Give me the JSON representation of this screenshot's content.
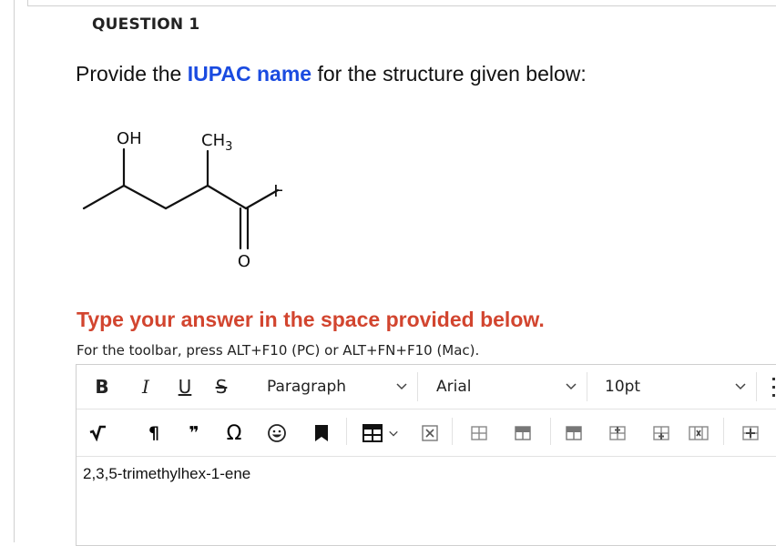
{
  "question": {
    "label": "QUESTION 1",
    "prompt_before": "Provide the ",
    "prompt_highlight": "IUPAC name",
    "prompt_after": " for the structure given below:"
  },
  "molecule": {
    "labels": {
      "oh": "OH",
      "ch3": "CH",
      "ch3_sub": "3",
      "h": "H",
      "o": "O"
    }
  },
  "instructions": {
    "main": "Type your answer in the space provided below.",
    "toolbar_hint": "For the toolbar, press ALT+F10 (PC) or ALT+FN+F10 (Mac)."
  },
  "toolbar": {
    "bold": "B",
    "italic": "I",
    "underline": "U",
    "strikethrough": "S",
    "paragraph": "Paragraph",
    "font": "Arial",
    "size": "10pt",
    "pilcrow": "¶",
    "quote": "❞",
    "omega": "Ω"
  },
  "editor": {
    "content": "2,3,5-trimethylhex-1-ene"
  },
  "colors": {
    "highlight_blue": "#1a4be0",
    "instruction_red": "#d2452f"
  }
}
